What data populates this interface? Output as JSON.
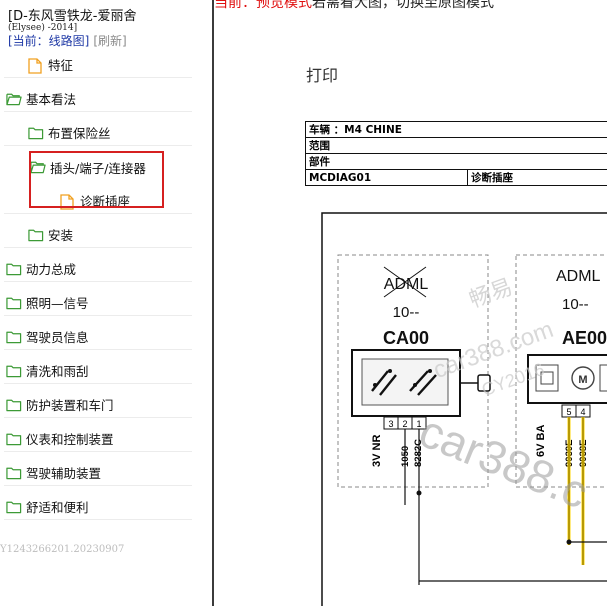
{
  "sidebar": {
    "title": "[D-东风雪铁龙-爱丽舍",
    "subtitle": "(Elysee)    -2014]",
    "current": "[当前：线路图]",
    "refresh": "[刷新]",
    "items": [
      {
        "label": "特征",
        "icon": "document-icon"
      },
      {
        "label": "基本看法",
        "icon": "folder-open-icon"
      },
      {
        "label": "布置保险丝",
        "icon": "folder-icon"
      },
      {
        "label": "插头/端子/连接器",
        "icon": "folder-open-icon"
      },
      {
        "label": "诊断插座",
        "icon": "document-icon"
      },
      {
        "label": "安装",
        "icon": "folder-icon"
      },
      {
        "label": "动力总成",
        "icon": "folder-icon"
      },
      {
        "label": "照明—信号",
        "icon": "folder-icon"
      },
      {
        "label": "驾驶员信息",
        "icon": "folder-icon"
      },
      {
        "label": "清洗和雨刮",
        "icon": "folder-icon"
      },
      {
        "label": "防护装置和车门",
        "icon": "folder-icon"
      },
      {
        "label": "仪表和控制装置",
        "icon": "folder-icon"
      },
      {
        "label": "驾驶辅助装置",
        "icon": "folder-icon"
      },
      {
        "label": "舒适和便利",
        "icon": "folder-icon"
      }
    ],
    "footer_code": "Y1243266201.20230907"
  },
  "main": {
    "notice_red": "当前：预览模式",
    "notice_dark": "若需看大图，切换至原图模式",
    "print_title": "打印",
    "table": {
      "vehicle": "车辆 ：M4 CHINE",
      "scope": "范围",
      "part": "部件",
      "code": "MCDIAG01",
      "name": "诊断插座"
    },
    "diagram": {
      "left_module": {
        "label": "ADML",
        "sub": "10--",
        "code": "CA00"
      },
      "right_module": {
        "label": "ADML",
        "sub": "10--",
        "code": "AE00"
      },
      "left_pins": [
        "3",
        "2",
        "1"
      ],
      "right_pins": [
        "5",
        "4"
      ],
      "left_wires": [
        "3V NR",
        "1050",
        "8282C"
      ],
      "right_wires": [
        "6V BA",
        "9039E",
        "9038E"
      ]
    },
    "watermarks": [
      "畅易",
      "car388.com",
      "CY2016",
      "car388.c"
    ]
  },
  "colors": {
    "highlight": "#d62020",
    "current_link": "#1f39a6",
    "notice": "#e01010",
    "folder": "#3c9a36",
    "document": "#f0a020",
    "watermark": "#c9c9c9",
    "wire_yellow": "#ffd400"
  }
}
